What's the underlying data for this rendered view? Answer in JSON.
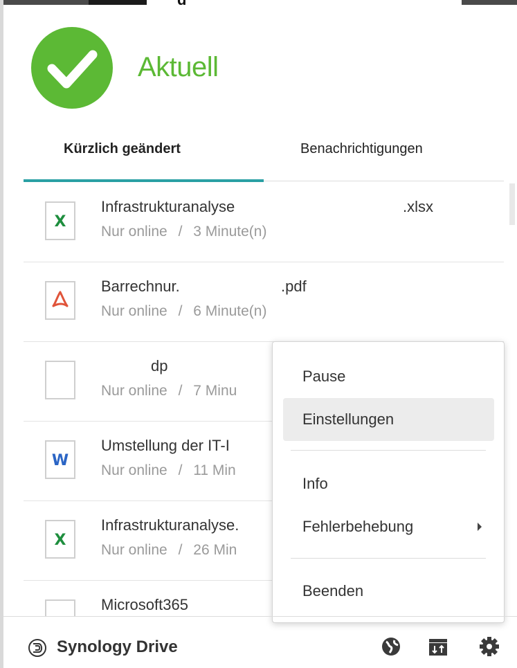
{
  "window": {
    "top_strip_text": "g"
  },
  "status": {
    "title": "Aktuell",
    "icon": "check-circle-icon",
    "color": "#5cb935"
  },
  "tabs": [
    {
      "label": "Kürzlich geändert",
      "active": true
    },
    {
      "label": "Benachrichtigungen",
      "active": false
    }
  ],
  "accent_color": "#2aa0a4",
  "files": [
    {
      "name": "Infrastrukturanalyse",
      "ext": ".xlsx",
      "type": "excel",
      "status": "Nur online",
      "time": "3 Minute(n)",
      "separator": "/"
    },
    {
      "name": "Barrechnur.",
      "ext": ".pdf",
      "type": "pdf",
      "status": "Nur online",
      "time": "6 Minute(n)",
      "separator": "/"
    },
    {
      "name": "dp",
      "ext": "",
      "type": "generic",
      "status": "Nur online",
      "time": "7 Minu",
      "separator": "/"
    },
    {
      "name": "Umstellung der IT-I",
      "ext": "",
      "type": "word",
      "status": "Nur online",
      "time": "11 Min",
      "separator": "/"
    },
    {
      "name": "Infrastrukturanalyse.",
      "ext": "",
      "type": "excel",
      "status": "Nur online",
      "time": "26 Min",
      "separator": "/"
    },
    {
      "name": "Microsoft365",
      "ext": "",
      "type": "generic",
      "status": "",
      "time": "",
      "separator": ""
    }
  ],
  "context_menu": {
    "items": [
      {
        "label": "Pause"
      },
      {
        "label": "Einstellungen",
        "hover": true
      },
      {
        "label": "Info"
      },
      {
        "label": "Fehlerbehebung",
        "submenu": true
      },
      {
        "label": "Beenden"
      }
    ]
  },
  "footer": {
    "app_name": "Synology Drive",
    "icons": [
      "globe-icon",
      "drive-folder-icon",
      "gear-icon"
    ]
  }
}
